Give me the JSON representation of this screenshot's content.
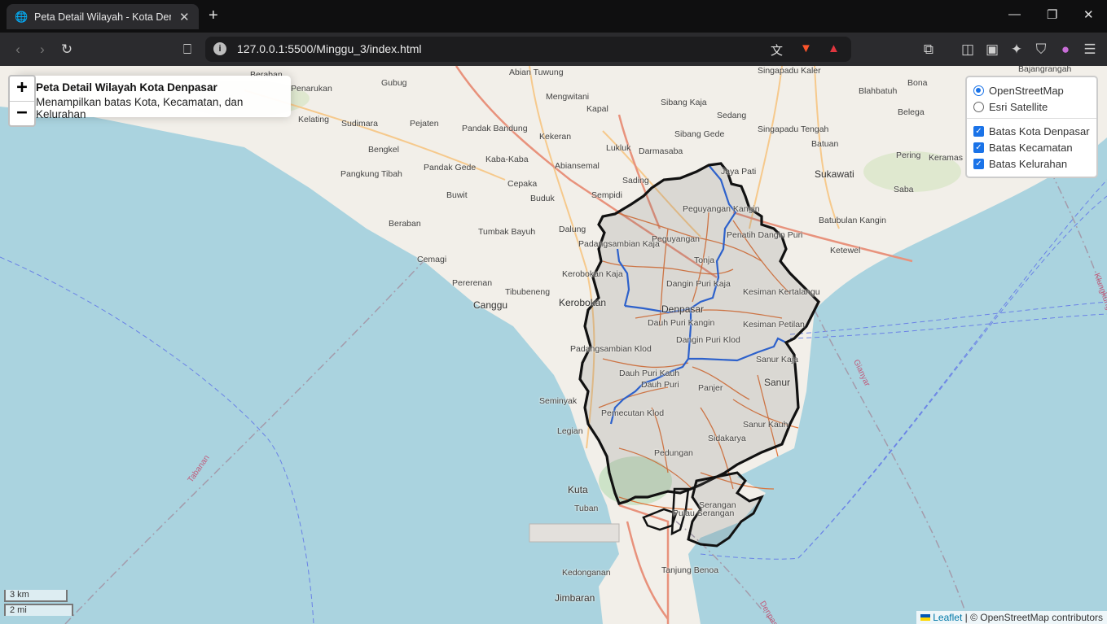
{
  "browser": {
    "tab_title": "Peta Detail Wilayah - Kota Denpasar",
    "url": "127.0.0.1:5500/Minggu_3/index.html"
  },
  "map": {
    "info": {
      "title": "Peta Detail Wilayah Kota Denpasar",
      "subtitle": "Menampilkan batas Kota, Kecamatan, dan Kelurahan"
    },
    "zoom": {
      "in": "+",
      "out": "−"
    },
    "layers": {
      "base": [
        {
          "label": "OpenStreetMap",
          "selected": true
        },
        {
          "label": "Esri Satellite",
          "selected": false
        }
      ],
      "overlays": [
        {
          "label": "Batas Kota Denpasar",
          "checked": true
        },
        {
          "label": "Batas Kecamatan",
          "checked": true
        },
        {
          "label": "Batas Kelurahan",
          "checked": true
        }
      ]
    },
    "scale": {
      "metric": "3 km",
      "imperial": "2 mi"
    },
    "attribution": {
      "leaflet": "Leaflet",
      "rest": "| © OpenStreetMap contributors"
    },
    "colors": {
      "sea": "#aad3df",
      "land": "#f2efe9",
      "city_boundary": "#111111",
      "kecamatan_boundary": "#1f5fe0",
      "kelurahan_boundary": "#e06a2a"
    },
    "places": [
      "Beraban",
      "Penarukan",
      "Gubug",
      "Abian Tuwung",
      "Mengwitani",
      "Kapal",
      "Sibang Kaja",
      "Singapadu Kaler",
      "Blahbatuh",
      "Bona",
      "Bajangrangah",
      "Sedang",
      "Kelating",
      "Sudimara",
      "Pejaten",
      "Pandak Bandung",
      "Kekeran",
      "Lukluk",
      "Darmasaba",
      "Sibang Gede",
      "Singapadu Tengah",
      "Batuan",
      "Belega",
      "Bengkel",
      "Pandak Gede",
      "Kaba-Kaba",
      "Abiansemal",
      "Jaya Pati",
      "Sukawati",
      "Pering",
      "Keramas",
      "Pangkung Tibah",
      "Cepaka",
      "Sading",
      "Buwit",
      "Buduk",
      "Sempidi",
      "Saba",
      "Beraban",
      "Tumbak Bayuh",
      "Dalung",
      "Batubulan Kangin",
      "Cemagi",
      "Padangsambian Kaja",
      "Peguyangan Kangin",
      "Peguyangan",
      "Penatih Dangin Puri",
      "Ketewel",
      "Pererenan",
      "Tibubeneng",
      "Kerobokan Kaja",
      "Tonja",
      "Dangin Puri Kaja",
      "Kesiman Kertalangu",
      "Canggu",
      "Kerobokan",
      "Denpasar",
      "Dauh Puri Kangin",
      "Kesiman Petilan",
      "Dangin Puri Klod",
      "Padangsambian Klod",
      "Sanur Kaja",
      "Dauh Puri Kauh",
      "Dauh Puri",
      "Panjer",
      "Sanur",
      "Seminyak",
      "Pemecutan Klod",
      "Sanur Kauh",
      "Legian",
      "Sidakarya",
      "Pedungan",
      "Kuta",
      "Tuban",
      "Serangan",
      "Pulau Serangan",
      "Kedonganan",
      "Tanjung Benoa",
      "Jimbaran",
      "Tabanan",
      "Gianyar",
      "Klungkung",
      "Denpasar"
    ]
  }
}
